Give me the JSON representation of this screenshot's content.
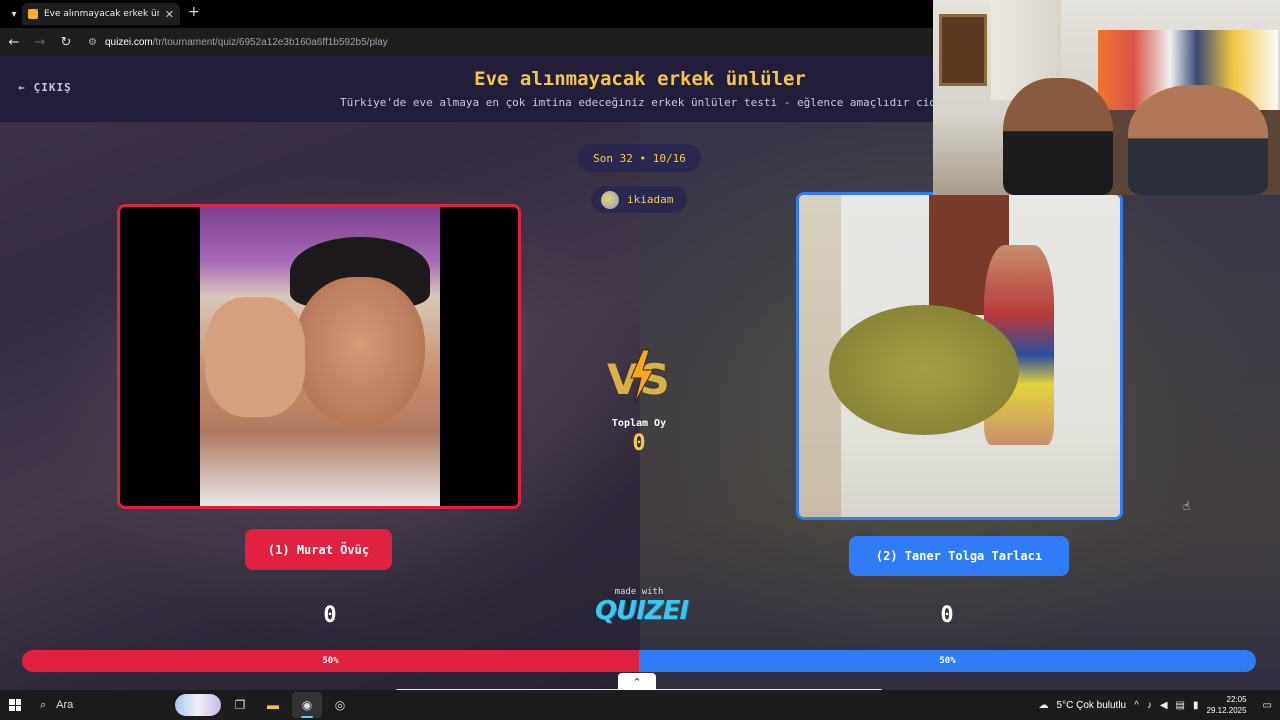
{
  "browser": {
    "tab_title": "Eve alınmayacak erkek ünlüler",
    "url_host": "quizei.com",
    "url_path": "/tr/tournament/quiz/6952a12e3b160a6ff1b592b5/play"
  },
  "quiz": {
    "exit_label": "ÇIKIŞ",
    "title": "Eve alınmayacak erkek ünlüler",
    "subtitle": "Türkiye'de eve almaya en çok imtina edeceğiniz erkek ünlüler testi - eğlence amaçlıdır cid…",
    "round_label": "Son 32 • 10/16",
    "username": "ikiadam",
    "total_votes_label": "Toplam Oy",
    "total_votes": "0",
    "made_with": "made with",
    "logo_text": "QUIZEI"
  },
  "left": {
    "name": "(1) Murat Övüç",
    "votes": "0",
    "percent": "50%",
    "share": 0.5,
    "color": "#e0213f"
  },
  "right": {
    "name": "(2) Taner Tolga Tarlacı",
    "votes": "0",
    "percent": "50%",
    "share": 0.5,
    "color": "#2f7cf6"
  },
  "taskbar": {
    "search_placeholder": "Ara",
    "weather": "5°C  Çok bulutlu",
    "time": "22:05",
    "date": "29.12.2025"
  }
}
